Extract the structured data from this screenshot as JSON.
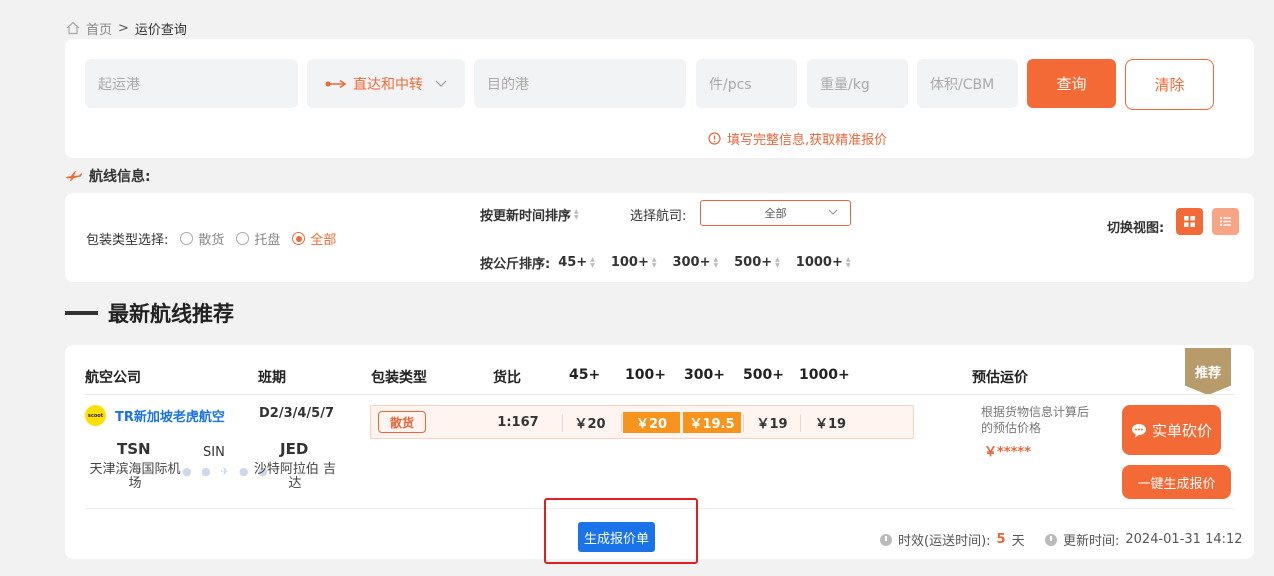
{
  "breadcrumb": {
    "home": "首页",
    "sep": ">",
    "current": "运价查询"
  },
  "search": {
    "origin_placeholder": "起运港",
    "mode_label": "直达和中转",
    "dest_placeholder": "目的港",
    "pcs_placeholder": "件/pcs",
    "weight_placeholder": "重量/kg",
    "volume_placeholder": "体积/CBM",
    "search_label": "查询",
    "clear_label": "清除",
    "hint": "填写完整信息,获取精准报价"
  },
  "route_info": {
    "title": "航线信息:"
  },
  "filters": {
    "pack_label": "包装类型选择:",
    "pack_options": [
      "散货",
      "托盘",
      "全部"
    ],
    "pack_selected": "全部",
    "sort_time_label": "按更新时间排序",
    "airline_label": "选择航司:",
    "airline_value": "全部",
    "sort_kg_label": "按公斤排序:",
    "kg_tiers": [
      "45+",
      "100+",
      "300+",
      "500+",
      "1000+"
    ],
    "view_label": "切换视图:"
  },
  "section": {
    "title": "最新航线推荐"
  },
  "table": {
    "headers": [
      "航空公司",
      "班期",
      "包装类型",
      "货比",
      "45+",
      "100+",
      "300+",
      "500+",
      "1000+",
      "预估运价"
    ],
    "badge": "推荐"
  },
  "row": {
    "logo_text": "scoot",
    "airline": "TR新加坡老虎航空",
    "schedule": "D2/3/4/5/7",
    "origin_code": "TSN",
    "origin_name": "天津滨海国际机场",
    "via": "SIN",
    "dest_code": "JED",
    "dest_name": "沙特阿拉伯 吉达",
    "pack_type": "散货",
    "ratio": "1:167",
    "prices": [
      "￥20",
      "￥20",
      "￥19.5",
      "￥19",
      "￥19"
    ],
    "est_note": "根据货物信息计算后的预估价格",
    "est_price": "￥*****",
    "bargain_label": "实单砍价",
    "quote_label": "一键生成报价"
  },
  "footer": {
    "gen_label": "生成报价单",
    "transit_label": "时效(运送时间):",
    "transit_value": "5",
    "transit_unit": "天",
    "updated_label": "更新时间:",
    "updated_value": "2024-01-31 14:12"
  },
  "colors": {
    "accent": "#f36a36",
    "link": "#1a73e8",
    "highlight": "#f7941d"
  }
}
